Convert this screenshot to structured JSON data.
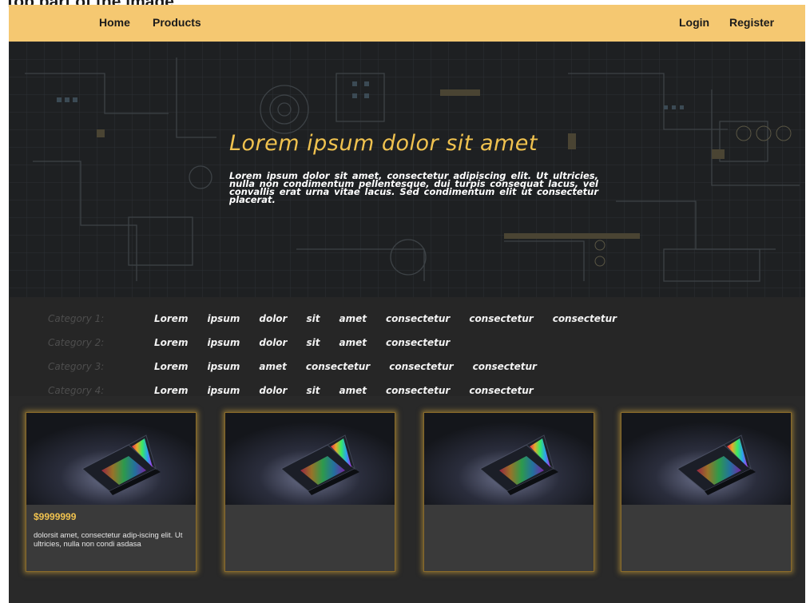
{
  "page": {
    "heading": "Top part of the image"
  },
  "navbar": {
    "home": "Home",
    "products": "Products",
    "login": "Login",
    "register": "Register",
    "bg_color": "#f5c871"
  },
  "hero": {
    "title": "Lorem ipsum dolor sit amet",
    "description": "Lorem ipsum dolor sit amet, consectetur adipiscing elit. Ut ultricies, nulla non condimentum pellentesque, dui turpis consequat lacus, vel convallis erat urna vitae lacus. Sed condimentum elit ut consectetur placerat.",
    "title_color": "#f0c24f"
  },
  "categories": [
    {
      "label": "Category 1:",
      "items": [
        "Lorem",
        "ipsum",
        "dolor",
        "sit",
        "amet",
        "consectetur",
        "consectetur",
        "consectetur"
      ]
    },
    {
      "label": "Category 2:",
      "items": [
        "Lorem",
        "ipsum",
        "dolor",
        "sit",
        "amet",
        "consectetur"
      ]
    },
    {
      "label": "Category 3:",
      "items": [
        "Lorem",
        "ipsum",
        "amet",
        "consectetur",
        "consectetur",
        "consectetur"
      ]
    },
    {
      "label": "Category 4:",
      "items": [
        "Lorem",
        "ipsum",
        "dolor",
        "sit",
        "amet",
        "consectetur",
        "consectetur"
      ]
    }
  ],
  "products": [
    {
      "price": "$9999999",
      "description": "dolorsit amet, consectetur adip-iscing elit. Ut ultricies, nulla non condi asdasa"
    },
    {
      "price": "",
      "description": ""
    },
    {
      "price": "",
      "description": ""
    },
    {
      "price": "",
      "description": ""
    }
  ],
  "colors": {
    "accent": "#f0c24f",
    "card_border_glow": "#d6a83c",
    "background": "#2b2b2b"
  }
}
